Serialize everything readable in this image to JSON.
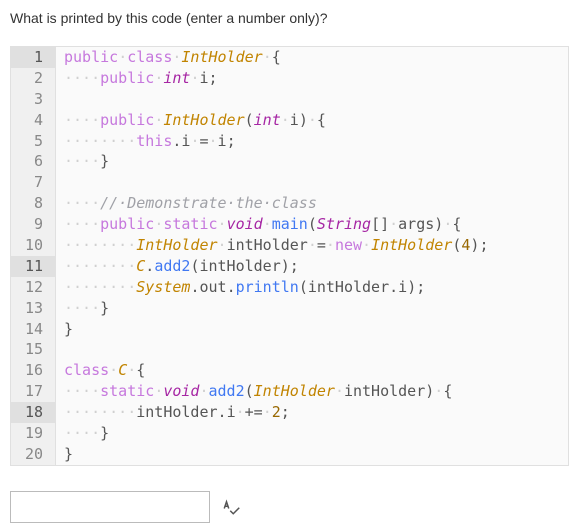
{
  "question": "What is printed by this code (enter a number only)?",
  "gutter": {
    "total_lines": 20,
    "highlighted": [
      1,
      11,
      18
    ]
  },
  "answer": {
    "value": "",
    "placeholder": ""
  },
  "code": {
    "lines": [
      [
        [
          "kw",
          "public"
        ],
        [
          "ws",
          "·"
        ],
        [
          "kw",
          "class"
        ],
        [
          "ws",
          "·"
        ],
        [
          "cls",
          "IntHolder"
        ],
        [
          "ws",
          "·"
        ],
        [
          "punct",
          "{"
        ]
      ],
      [
        [
          "ws",
          "····"
        ],
        [
          "kw",
          "public"
        ],
        [
          "ws",
          "·"
        ],
        [
          "type",
          "int"
        ],
        [
          "ws",
          "·"
        ],
        [
          "ident",
          "i"
        ],
        [
          "punct",
          ";"
        ]
      ],
      [],
      [
        [
          "ws",
          "····"
        ],
        [
          "kw",
          "public"
        ],
        [
          "ws",
          "·"
        ],
        [
          "cls",
          "IntHolder"
        ],
        [
          "punct",
          "("
        ],
        [
          "type",
          "int"
        ],
        [
          "ws",
          "·"
        ],
        [
          "ident",
          "i"
        ],
        [
          "punct",
          ")"
        ],
        [
          "ws",
          "·"
        ],
        [
          "punct",
          "{"
        ]
      ],
      [
        [
          "ws",
          "········"
        ],
        [
          "this",
          "this"
        ],
        [
          "punct",
          "."
        ],
        [
          "ident",
          "i"
        ],
        [
          "ws",
          "·"
        ],
        [
          "punct",
          "="
        ],
        [
          "ws",
          "·"
        ],
        [
          "ident",
          "i"
        ],
        [
          "punct",
          ";"
        ]
      ],
      [
        [
          "ws",
          "····"
        ],
        [
          "punct",
          "}"
        ]
      ],
      [],
      [
        [
          "ws",
          "····"
        ],
        [
          "comment",
          "//·Demonstrate·the·class"
        ]
      ],
      [
        [
          "ws",
          "····"
        ],
        [
          "kw",
          "public"
        ],
        [
          "ws",
          "·"
        ],
        [
          "kw",
          "static"
        ],
        [
          "ws",
          "·"
        ],
        [
          "type",
          "void"
        ],
        [
          "ws",
          "·"
        ],
        [
          "method",
          "main"
        ],
        [
          "punct",
          "("
        ],
        [
          "type",
          "String"
        ],
        [
          "punct",
          "[]"
        ],
        [
          "ws",
          "·"
        ],
        [
          "ident",
          "args"
        ],
        [
          "punct",
          ")"
        ],
        [
          "ws",
          "·"
        ],
        [
          "punct",
          "{"
        ]
      ],
      [
        [
          "ws",
          "········"
        ],
        [
          "cls",
          "IntHolder"
        ],
        [
          "ws",
          "·"
        ],
        [
          "ident",
          "intHolder"
        ],
        [
          "ws",
          "·"
        ],
        [
          "punct",
          "="
        ],
        [
          "ws",
          "·"
        ],
        [
          "kw",
          "new"
        ],
        [
          "ws",
          "·"
        ],
        [
          "cls",
          "IntHolder"
        ],
        [
          "punct",
          "("
        ],
        [
          "num",
          "4"
        ],
        [
          "punct",
          ")"
        ],
        [
          "punct",
          ";"
        ]
      ],
      [
        [
          "ws",
          "········"
        ],
        [
          "cls",
          "C"
        ],
        [
          "punct",
          "."
        ],
        [
          "method",
          "add2"
        ],
        [
          "punct",
          "("
        ],
        [
          "ident",
          "intHolder"
        ],
        [
          "punct",
          ")"
        ],
        [
          "punct",
          ";"
        ]
      ],
      [
        [
          "ws",
          "········"
        ],
        [
          "cls",
          "System"
        ],
        [
          "punct",
          "."
        ],
        [
          "ident",
          "out"
        ],
        [
          "punct",
          "."
        ],
        [
          "method",
          "println"
        ],
        [
          "punct",
          "("
        ],
        [
          "ident",
          "intHolder"
        ],
        [
          "punct",
          "."
        ],
        [
          "ident",
          "i"
        ],
        [
          "punct",
          ")"
        ],
        [
          "punct",
          ";"
        ]
      ],
      [
        [
          "ws",
          "····"
        ],
        [
          "punct",
          "}"
        ]
      ],
      [
        [
          "punct",
          "}"
        ]
      ],
      [],
      [
        [
          "kw",
          "class"
        ],
        [
          "ws",
          "·"
        ],
        [
          "cls",
          "C"
        ],
        [
          "ws",
          "·"
        ],
        [
          "punct",
          "{"
        ]
      ],
      [
        [
          "ws",
          "····"
        ],
        [
          "kw",
          "static"
        ],
        [
          "ws",
          "·"
        ],
        [
          "type",
          "void"
        ],
        [
          "ws",
          "·"
        ],
        [
          "method",
          "add2"
        ],
        [
          "punct",
          "("
        ],
        [
          "cls",
          "IntHolder"
        ],
        [
          "ws",
          "·"
        ],
        [
          "ident",
          "intHolder"
        ],
        [
          "punct",
          ")"
        ],
        [
          "ws",
          "·"
        ],
        [
          "punct",
          "{"
        ]
      ],
      [
        [
          "ws",
          "········"
        ],
        [
          "ident",
          "intHolder"
        ],
        [
          "punct",
          "."
        ],
        [
          "ident",
          "i"
        ],
        [
          "ws",
          "·"
        ],
        [
          "punct",
          "+="
        ],
        [
          "ws",
          "·"
        ],
        [
          "num",
          "2"
        ],
        [
          "punct",
          ";"
        ]
      ],
      [
        [
          "ws",
          "····"
        ],
        [
          "punct",
          "}"
        ]
      ],
      [
        [
          "punct",
          "}"
        ]
      ]
    ]
  },
  "icon": {
    "spellcheck": "spellcheck-icon"
  }
}
